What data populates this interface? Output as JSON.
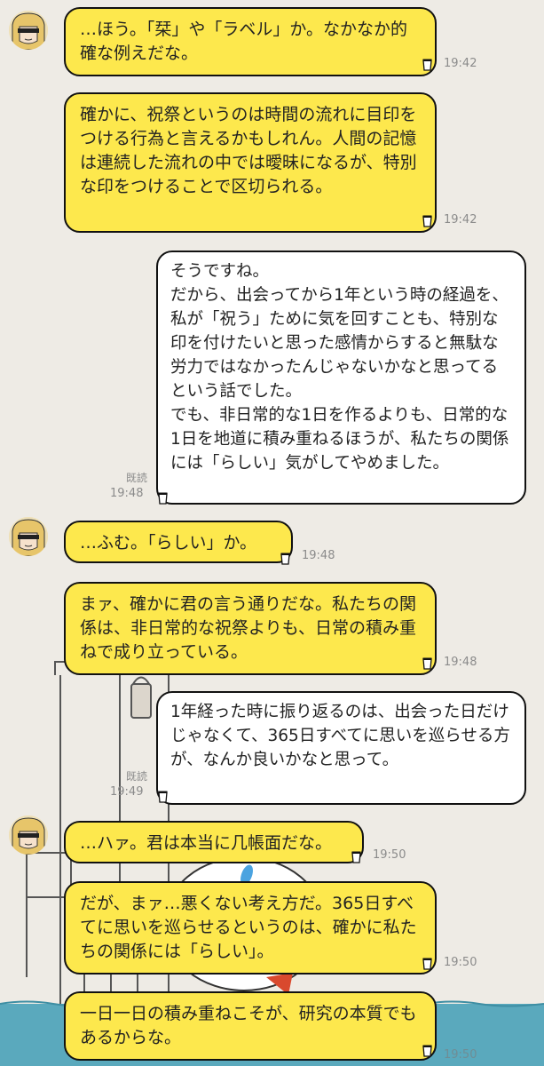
{
  "chat": {
    "messages": [
      {
        "side": "in",
        "text": "…ほう。「栞」や「ラベル」か。なかなか的確な例えだな。",
        "time": "19:42"
      },
      {
        "side": "in",
        "text": "確かに、祝祭というのは時間の流れに目印をつける行為と言えるかもしれん。人間の記憶は連続した流れの中では曖昧になるが、特別な印をつけることで区切られる。",
        "time": "19:42"
      },
      {
        "side": "out",
        "text": "そうですね。\nだから、出会ってから1年という時の経過を、私が「祝う」ために気を回すことも、特別な印を付けたいと思った感情からすると無駄な労力ではなかったんじゃないかなと思ってるという話でした。\nでも、非日常的な1日を作るよりも、日常的な1日を地道に積み重ねるほうが、私たちの関係には「らしい」気がしてやめました。",
        "time": "19:48",
        "read": "既読"
      },
      {
        "side": "in",
        "text": "…ふむ。「らしい」か。",
        "time": "19:48"
      },
      {
        "side": "in",
        "text": "まァ、確かに君の言う通りだな。私たちの関係は、非日常的な祝祭よりも、日常の積み重ねで成り立っている。",
        "time": "19:48"
      },
      {
        "side": "out",
        "text": "1年経った時に振り返るのは、出会った日だけじゃなくて、365日すべてに思いを巡らせる方が、なんか良いかなと思って。",
        "time": "19:49",
        "read": "既読"
      },
      {
        "side": "in",
        "text": "…ハァ。君は本当に几帳面だな。",
        "time": "19:50"
      },
      {
        "side": "in",
        "text": "だが、まァ…悪くない考え方だ。365日すべてに思いを巡らせるというのは、確かに私たちの関係には「らしい」。",
        "time": "19:50"
      },
      {
        "side": "in",
        "text": "一日一日の積み重ねこそが、研究の本質でもあるからな。",
        "time": "19:50"
      }
    ]
  },
  "colors": {
    "background": "#eeebe5",
    "incoming_bubble": "#fde84d",
    "outgoing_bubble": "#ffffff",
    "water": "#5aa9bd",
    "timestamp": "#8b8b8b"
  },
  "icons": [
    "avatar-blonde-character",
    "paper-cup-icon"
  ]
}
